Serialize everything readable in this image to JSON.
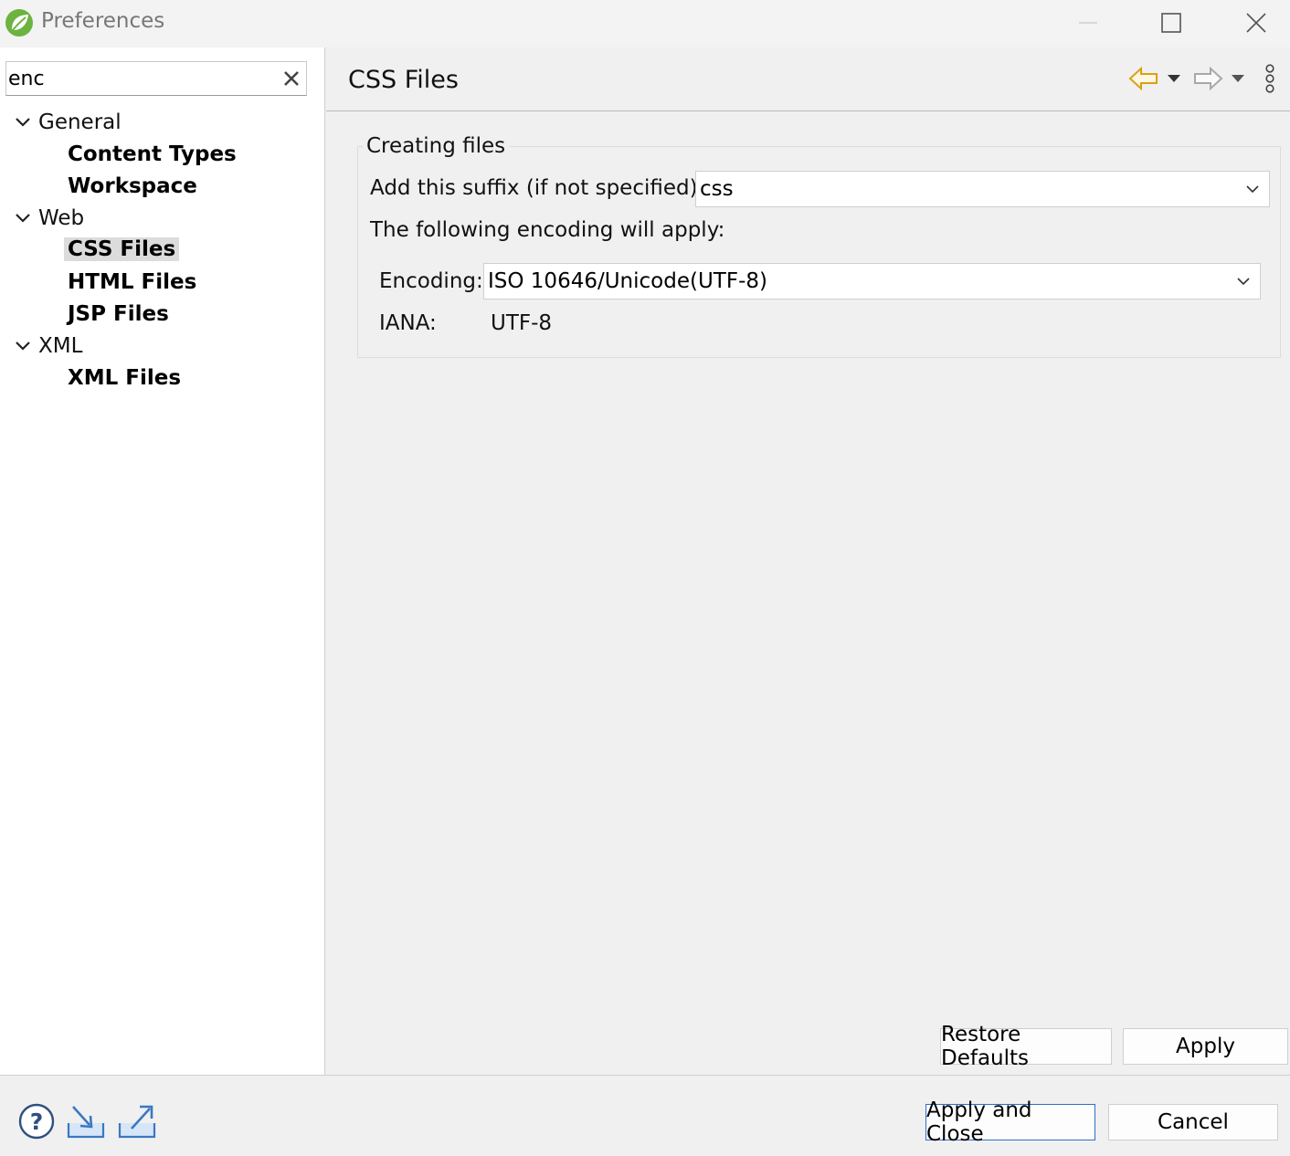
{
  "window": {
    "title": "Preferences",
    "icon": "spring-leaf-icon"
  },
  "filter": {
    "value": "enc"
  },
  "tree": {
    "general": {
      "label": "General",
      "children": [
        "Content Types",
        "Workspace"
      ]
    },
    "web": {
      "label": "Web",
      "children": [
        "CSS Files",
        "HTML Files",
        "JSP Files"
      ]
    },
    "xml": {
      "label": "XML",
      "children": [
        "XML Files"
      ]
    },
    "selected": "CSS Files"
  },
  "page": {
    "title": "CSS Files",
    "group_title": "Creating files",
    "suffix_label": "Add this suffix (if not specified):",
    "suffix_value": "css",
    "encoding_intro": "The following encoding will apply:",
    "encoding_label": "Encoding:",
    "encoding_value": "ISO 10646/Unicode(UTF-8)",
    "iana_label": "IANA:",
    "iana_value": "UTF-8"
  },
  "buttons": {
    "restore_defaults": "Restore Defaults",
    "apply": "Apply",
    "apply_and_close": "Apply and Close",
    "cancel": "Cancel"
  },
  "colors": {
    "accent_border": "#2d6fcc",
    "back_arrow": "#d9a015",
    "spring_green": "#6db33f"
  }
}
